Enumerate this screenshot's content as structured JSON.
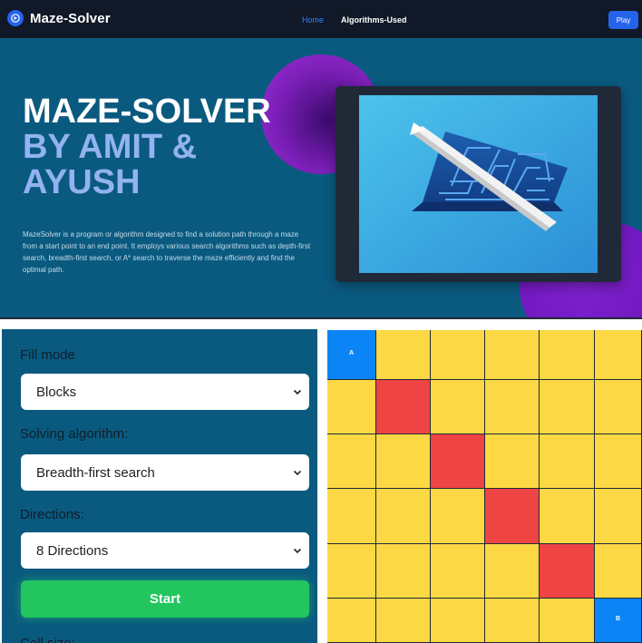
{
  "navbar": {
    "brand": "Maze-Solver",
    "links": [
      "Home",
      "Algorithms-Used"
    ],
    "play": "Play"
  },
  "hero": {
    "title": "MAZE-SOLVER",
    "subtitle_line1": "BY AMIT &",
    "subtitle_line2": "AYUSH",
    "description": "MazeSolver is a program or algorithm designed to find a solution path through a maze from a start point to an end point. It employs various search algorithms such as depth-first search, breadth-first search, or A* search to traverse the maze efficiently and find the optimal path."
  },
  "controls": {
    "fill_mode_label": "Fill mode",
    "fill_mode_value": "Blocks",
    "algorithm_label": "Solving algorithm:",
    "algorithm_value": "Breadth-first search",
    "directions_label": "Directions:",
    "directions_value": "8 Directions",
    "start_label": "Start",
    "cell_size_label": "Cell size:"
  },
  "grid": {
    "start_label": "A",
    "end_label": "B",
    "cells": [
      [
        "start",
        "empty",
        "empty",
        "empty",
        "empty",
        "empty"
      ],
      [
        "empty",
        "wall",
        "empty",
        "empty",
        "empty",
        "empty"
      ],
      [
        "empty",
        "empty",
        "wall",
        "empty",
        "empty",
        "empty"
      ],
      [
        "empty",
        "empty",
        "empty",
        "wall",
        "empty",
        "empty"
      ],
      [
        "empty",
        "empty",
        "empty",
        "empty",
        "wall",
        "empty"
      ],
      [
        "empty",
        "empty",
        "empty",
        "empty",
        "empty",
        "end"
      ]
    ]
  },
  "colors": {
    "navbar": "#111827",
    "hero_bg": "#0a5a80",
    "accent_blue": "#2563eb",
    "start_button": "#22c55e",
    "empty_cell": "#fcd944",
    "wall_cell": "#ef4444",
    "endpoint_cell": "#0b84f5"
  }
}
